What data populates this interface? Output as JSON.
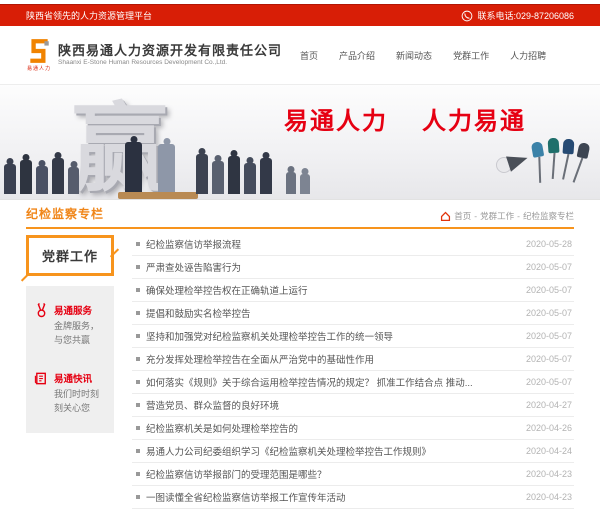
{
  "topbar": {
    "tagline": "陕西省领先的人力资源管理平台",
    "phone_label": "联系电话:029-87206086"
  },
  "header": {
    "logo_caption": "易通人力",
    "company_cn": "陕西易通人力资源开发有限责任公司",
    "company_en": "Shaanxi E-Stone Human Resources Development Co.,Ltd.",
    "nav": [
      {
        "label": "首页"
      },
      {
        "label": "产品介绍"
      },
      {
        "label": "新闻动态"
      },
      {
        "label": "党群工作"
      },
      {
        "label": "人力招聘"
      }
    ]
  },
  "banner": {
    "big_char": "赢",
    "slogan_1": "易通人力",
    "slogan_2": "人力易通"
  },
  "sidebar": {
    "title": "党群工作",
    "items": [
      {
        "icon": "medal-icon",
        "title": "易通服务",
        "desc": "金牌服务，与您共赢"
      },
      {
        "icon": "news-icon",
        "title": "易通快讯",
        "desc": "我们时时刻刻关心您"
      }
    ]
  },
  "main": {
    "section_title": "纪检监察专栏",
    "breadcrumb": {
      "items": [
        "首页",
        "党群工作",
        "纪检监察专栏"
      ],
      "sep": "-"
    },
    "articles": [
      {
        "title": "纪检监察信访举报流程",
        "date": "2020-05-28"
      },
      {
        "title": "严肃查处诬告陷害行为",
        "date": "2020-05-07"
      },
      {
        "title": "确保处理检举控告权在正确轨道上运行",
        "date": "2020-05-07"
      },
      {
        "title": "提倡和鼓励实名检举控告",
        "date": "2020-05-07"
      },
      {
        "title": "坚持和加强党对纪检监察机关处理检举控告工作的统一领导",
        "date": "2020-05-07"
      },
      {
        "title": "充分发挥处理检举控告在全面从严治党中的基础性作用",
        "date": "2020-05-07"
      },
      {
        "title": "如何落实《规则》关于综合运用检举控告情况的规定？ 抓准工作结合点 推动...",
        "date": "2020-05-07"
      },
      {
        "title": "营造党员、群众监督的良好环境",
        "date": "2020-04-27"
      },
      {
        "title": "纪检监察机关是如何处理检举控告的",
        "date": "2020-04-26"
      },
      {
        "title": "易通人力公司纪委组织学习《纪检监察机关处理检举控告工作规则》",
        "date": "2020-04-24"
      },
      {
        "title": "纪检监察信访举报部门的受理范围是哪些？",
        "date": "2020-04-23"
      },
      {
        "title": "一图读懂全省纪检监察信访举报工作宣传年活动",
        "date": "2020-04-23"
      }
    ]
  },
  "colors": {
    "brand_red": "#d81e06",
    "slogan_red": "#e60012",
    "accent_orange": "#f7941d",
    "title_orange": "#f08619"
  }
}
